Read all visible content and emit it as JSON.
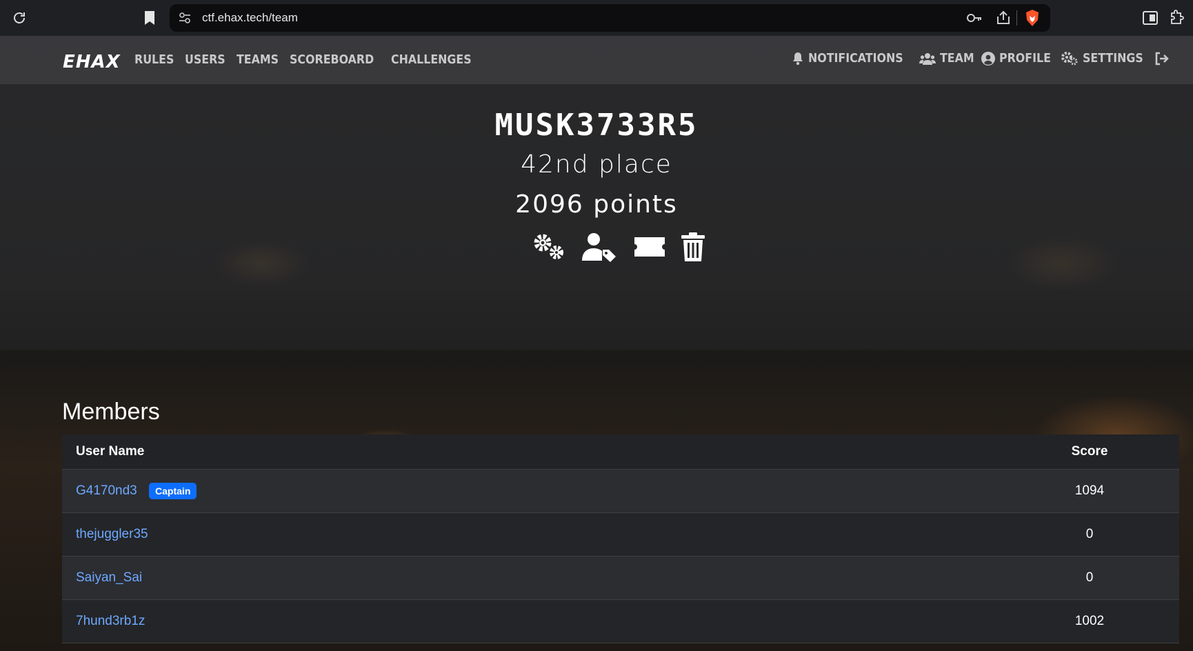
{
  "browser": {
    "url": "ctf.ehax.tech/team"
  },
  "nav": {
    "logo": "EHAX",
    "links": [
      "RULES",
      "USERS",
      "TEAMS",
      "SCOREBOARD",
      "CHALLENGES"
    ],
    "right": {
      "notifications": "NOTIFICATIONS",
      "team": "TEAM",
      "profile": "PROFILE",
      "settings": "SETTINGS"
    }
  },
  "team": {
    "name": "MUSK3733R5",
    "place": "42nd place",
    "points": "2096 points",
    "actions": [
      "gears-icon",
      "user-tag-icon",
      "ticket-icon",
      "trash-icon"
    ]
  },
  "members": {
    "title": "Members",
    "columns": {
      "user": "User Name",
      "score": "Score"
    },
    "rows": [
      {
        "name": "G4170nd3",
        "badge": "Captain",
        "score": "1094"
      },
      {
        "name": "thejuggler35",
        "score": "0"
      },
      {
        "name": "Saiyan_Sai",
        "score": "0"
      },
      {
        "name": "7hund3rb1z",
        "score": "1002"
      }
    ]
  },
  "colors": {
    "link": "#6ea8fe",
    "badge": "#0d6efd",
    "brave": "#fb542b"
  }
}
